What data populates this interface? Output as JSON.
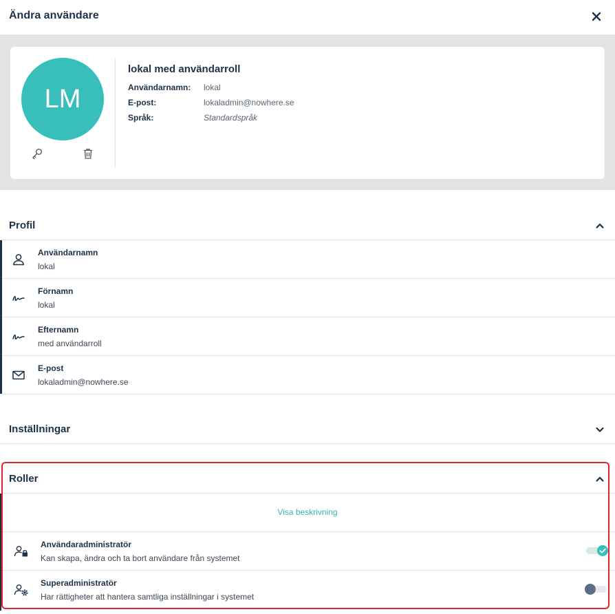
{
  "header": {
    "title": "Ändra användare"
  },
  "profile_card": {
    "initials": "LM",
    "avatar_color": "#39bfbb",
    "name": "lokal med användarroll",
    "fields": [
      {
        "label": "Användarnamn:",
        "value": "lokal"
      },
      {
        "label": "E-post:",
        "value": "lokaladmin@nowhere.se"
      },
      {
        "label": "Språk:",
        "value": "Standardspråk"
      }
    ],
    "actions": {
      "reset_password": "key-icon",
      "delete": "trash-icon"
    }
  },
  "profile_section": {
    "title": "Profil",
    "expanded": true,
    "rows": [
      {
        "icon": "user-icon",
        "label": "Användarnamn",
        "value": "lokal"
      },
      {
        "icon": "signature-icon",
        "label": "Förnamn",
        "value": "lokal"
      },
      {
        "icon": "signature-icon",
        "label": "Efternamn",
        "value": "med användarroll"
      },
      {
        "icon": "envelope-icon",
        "label": "E-post",
        "value": "lokaladmin@nowhere.se"
      }
    ]
  },
  "settings_section": {
    "title": "Inställningar",
    "expanded": false
  },
  "roles_section": {
    "title": "Roller",
    "expanded": true,
    "show_description": "Visa beskrivning",
    "roles": [
      {
        "icon": "user-lock-icon",
        "label": "Användaradministratör",
        "description": "Kan skapa, ändra och ta bort användare från systemet",
        "enabled": true
      },
      {
        "icon": "user-gear-icon",
        "label": "Superadministratör",
        "description": "Har rättigheter att hantera samtliga inställningar i systemet",
        "enabled": false
      }
    ]
  },
  "colors": {
    "primary": "#1d3147",
    "accent": "#39bfbb",
    "highlight": "#e0262c"
  }
}
